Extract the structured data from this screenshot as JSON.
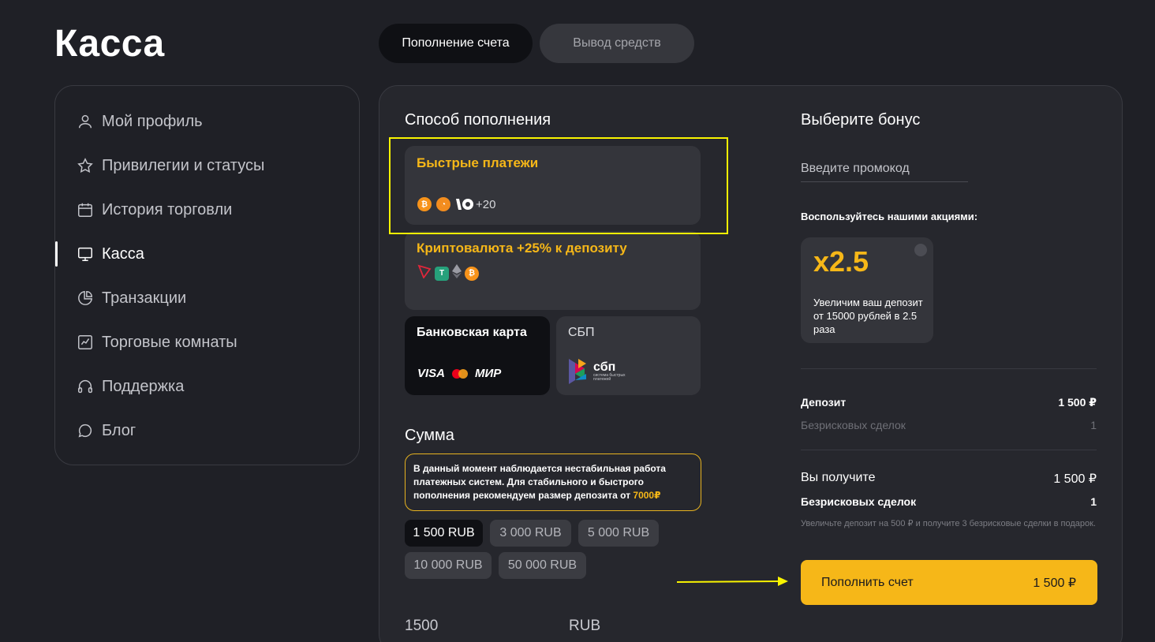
{
  "page": {
    "title": "Касса"
  },
  "tabs": [
    {
      "label": "Пополнение счета",
      "active": true
    },
    {
      "label": "Вывод средств",
      "active": false
    }
  ],
  "sidebar": {
    "items": [
      {
        "label": "Мой профиль",
        "icon": "user-icon"
      },
      {
        "label": "Привилегии и статусы",
        "icon": "star-icon"
      },
      {
        "label": "История торговли",
        "icon": "calendar-icon"
      },
      {
        "label": "Касса",
        "icon": "monitor-icon",
        "active": true
      },
      {
        "label": "Транзакции",
        "icon": "pie-chart-icon"
      },
      {
        "label": "Торговые комнаты",
        "icon": "line-chart-icon"
      },
      {
        "label": "Поддержка",
        "icon": "headphones-icon"
      },
      {
        "label": "Блог",
        "icon": "chat-bubble-icon"
      }
    ]
  },
  "deposit": {
    "method_title": "Способ пополнения",
    "methods": {
      "fast": {
        "title": "Быстрые платежи",
        "more": "+20"
      },
      "crypto": {
        "title": "Криптовалюта +25% к депозиту"
      },
      "card": {
        "title": "Банковская карта",
        "brands": [
          "VISA",
          "МИР"
        ]
      },
      "sbp": {
        "title": "СБП",
        "logo_text": "сбп",
        "logo_sub": "система быстрых платежей"
      }
    },
    "amount_title": "Сумма",
    "notice_text": "В данный момент наблюдается нестабильная работа платежных систем. Для стабильного и быстрого пополнения рекомендуем размер депозита от ",
    "notice_amount": "7000₽",
    "presets": [
      "1 500 RUB",
      "3 000 RUB",
      "5 000 RUB",
      "10 000 RUB",
      "50 000 RUB"
    ],
    "amount_value": "1500",
    "currency": "RUB"
  },
  "bonus": {
    "title": "Выберите бонус",
    "promo_placeholder": "Введите промокод",
    "promo_sub": "Воспользуйтесь нашими акциями:",
    "card": {
      "multiplier": "x2.5",
      "text": "Увеличим ваш депозит от 15000 рублей в 2.5 раза"
    }
  },
  "summary": {
    "deposit_label": "Депозит",
    "deposit_value": "1 500 ₽",
    "riskfree_label": "Безрисковых сделок",
    "riskfree_value": "1",
    "receive_label": "Вы получите",
    "receive_value": "1 500 ₽",
    "receive_riskfree_label": "Безрисковых сделок",
    "receive_riskfree_value": "1",
    "hint": "Увеличьте депозит на 500 ₽ и получите 3 безрисковые сделки в подарок."
  },
  "cta": {
    "label": "Пополнить счет",
    "amount": "1 500 ₽"
  },
  "colors": {
    "accent": "#f6b718",
    "highlight": "#f9f400",
    "bg": "#1f2026",
    "panel": "#26272d"
  }
}
